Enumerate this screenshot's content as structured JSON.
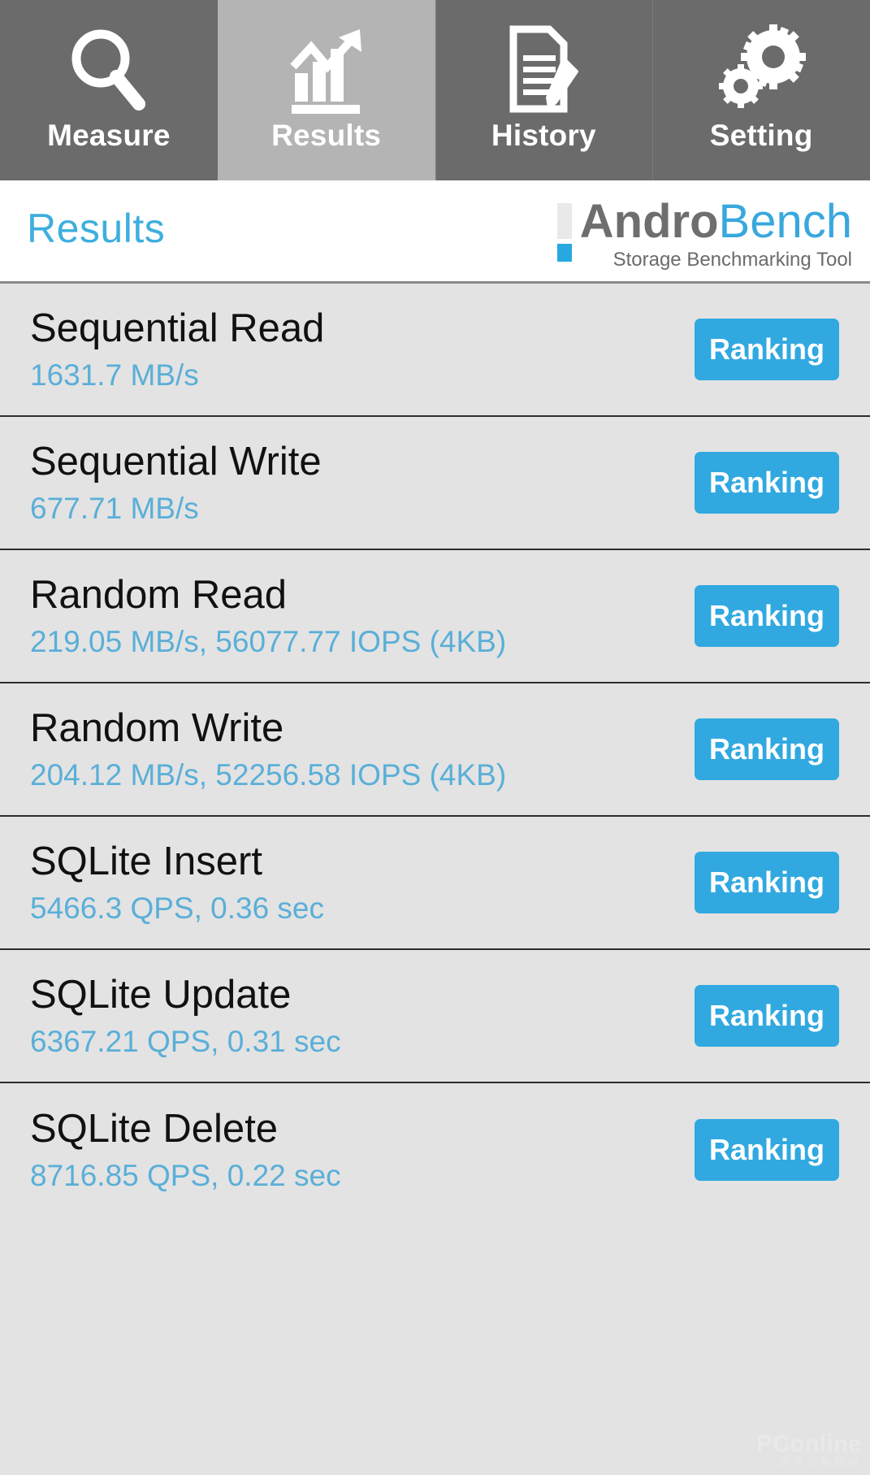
{
  "tabs": [
    {
      "label": "Measure",
      "icon": "magnifier-icon",
      "active": false
    },
    {
      "label": "Results",
      "icon": "bar-chart-trend-icon",
      "active": true
    },
    {
      "label": "History",
      "icon": "document-pencil-icon",
      "active": false
    },
    {
      "label": "Setting",
      "icon": "gears-icon",
      "active": false
    }
  ],
  "header": {
    "title": "Results",
    "logo": {
      "word_primary": "Andro",
      "word_secondary": "Bench",
      "tagline": "Storage Benchmarking Tool"
    }
  },
  "results": [
    {
      "title": "Sequential Read",
      "value": "1631.7 MB/s",
      "button": "Ranking"
    },
    {
      "title": "Sequential Write",
      "value": "677.71 MB/s",
      "button": "Ranking"
    },
    {
      "title": "Random Read",
      "value": "219.05 MB/s, 56077.77 IOPS (4KB)",
      "button": "Ranking"
    },
    {
      "title": "Random Write",
      "value": "204.12 MB/s, 52256.58 IOPS (4KB)",
      "button": "Ranking"
    },
    {
      "title": "SQLite Insert",
      "value": "5466.3 QPS, 0.36 sec",
      "button": "Ranking"
    },
    {
      "title": "SQLite Update",
      "value": "6367.21 QPS, 0.31 sec",
      "button": "Ranking"
    },
    {
      "title": "SQLite Delete",
      "value": "8716.85 QPS, 0.22 sec",
      "button": "Ranking"
    }
  ],
  "watermark": {
    "main": "PConline",
    "sub": "太平洋电脑网"
  },
  "colors": {
    "accent": "#31a9e0",
    "value_text": "#5aafd8",
    "tab_inactive": "#6b6b6b",
    "tab_active": "#b4b4b4",
    "row_bg": "#e3e3e3"
  }
}
